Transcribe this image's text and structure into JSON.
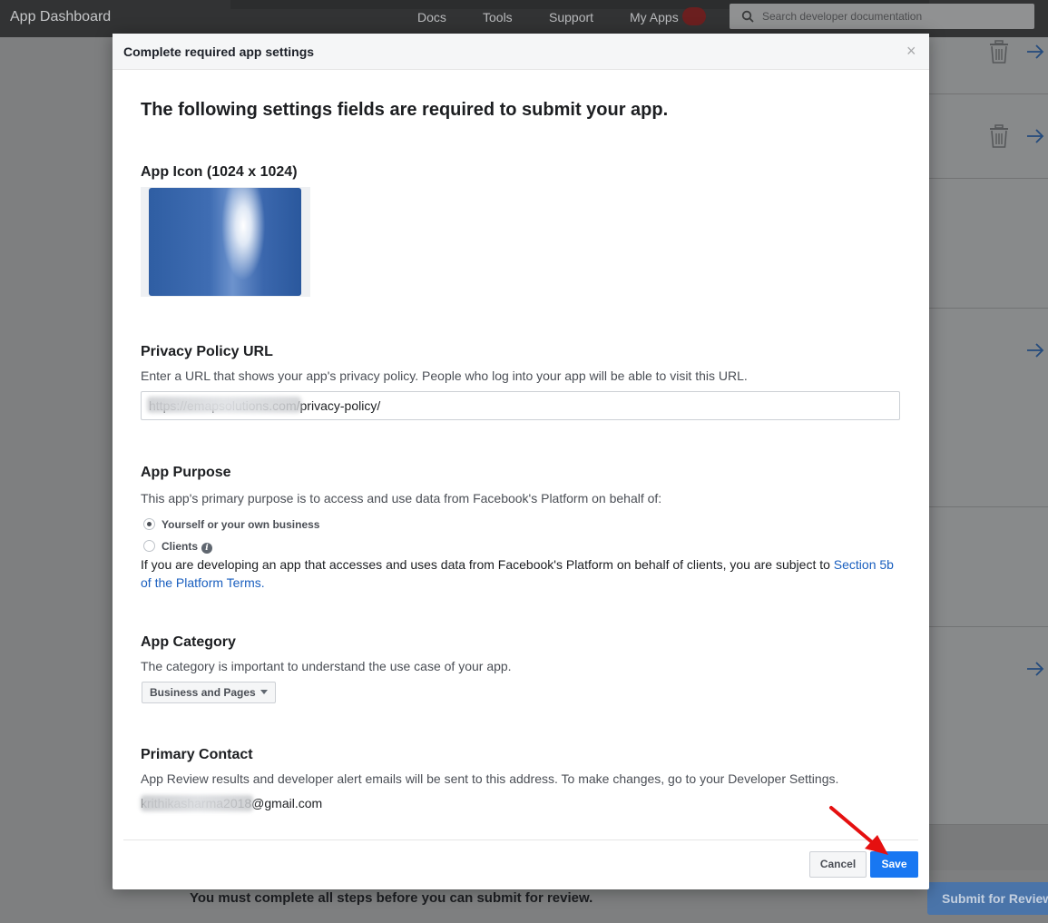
{
  "topbar": {
    "brand": "App Dashboard",
    "nav": [
      "Docs",
      "Tools",
      "Support",
      "My Apps"
    ],
    "search_placeholder": "Search developer documentation"
  },
  "background": {
    "footer_text": "You must complete all steps before you can submit for review.",
    "submit_button": "Submit for Review"
  },
  "modal": {
    "title": "Complete required app settings",
    "close_glyph": "×",
    "intro": "The following settings fields are required to submit your app.",
    "app_icon": {
      "title": "App Icon (1024 x 1024)"
    },
    "privacy": {
      "title": "Privacy Policy URL",
      "description": "Enter a URL that shows your app's privacy policy. People who log into your app will be able to visit this URL.",
      "value": "https://emapsolutions.com/privacy-policy/"
    },
    "purpose": {
      "title": "App Purpose",
      "description": "This app's primary purpose is to access and use data from Facebook's Platform on behalf of:",
      "options": [
        "Yourself or your own business",
        "Clients"
      ],
      "selected": "Yourself or your own business",
      "note_text": "If you are developing an app that accesses and uses data from Facebook's Platform on behalf of clients, you are subject to ",
      "note_link": "Section 5b of the Platform Terms."
    },
    "category": {
      "title": "App Category",
      "description": "The category is important to understand the use case of your app.",
      "selected": "Business and Pages"
    },
    "contact": {
      "title": "Primary Contact",
      "description": "App Review results and developer alert emails will be sent to this address. To make changes, go to your Developer Settings.",
      "email": "krithikasharma2018@gmail.com"
    },
    "buttons": {
      "cancel": "Cancel",
      "save": "Save"
    }
  },
  "colors": {
    "primary": "#1877f2",
    "link": "#1a5fbf",
    "annotation": "#e51010"
  }
}
